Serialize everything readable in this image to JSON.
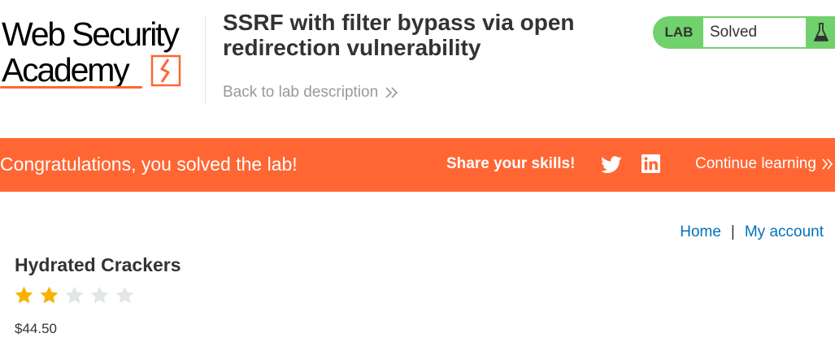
{
  "logo": {
    "line1": "Web Security",
    "line2": "Academy"
  },
  "lab": {
    "title": "SSRF with filter bypass via open redirection vulnerability",
    "back_link": "Back to lab description",
    "status_label": "LAB",
    "status_text": "Solved"
  },
  "banner": {
    "congrats": "Congratulations, you solved the lab!",
    "share": "Share your skills!",
    "continue": "Continue learning"
  },
  "nav": {
    "home": "Home",
    "separator": "|",
    "account": "My account"
  },
  "product": {
    "name": "Hydrated Crackers",
    "rating": 2,
    "rating_max": 5,
    "price": "$44.50"
  },
  "colors": {
    "accent": "#ff6633",
    "status_green": "#70d16d",
    "link_blue": "#0071bc",
    "star_filled": "#f8b300",
    "star_empty": "#e2e6e8"
  },
  "icons": [
    "logo-mark-icon",
    "chevron-double-right-icon",
    "flask-icon",
    "twitter-icon",
    "linkedin-icon",
    "star-icon"
  ]
}
